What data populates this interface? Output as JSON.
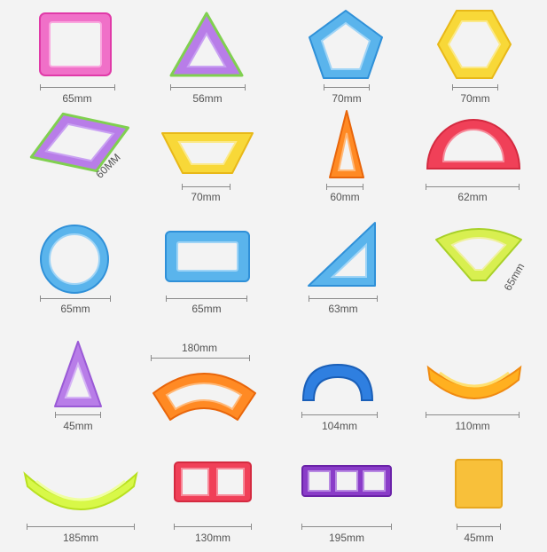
{
  "pieces": [
    {
      "name": "square",
      "size": "65mm"
    },
    {
      "name": "triangle",
      "size": "56mm"
    },
    {
      "name": "pentagon",
      "size": "70mm"
    },
    {
      "name": "hexagon",
      "size": "70mm"
    },
    {
      "name": "rhombus",
      "size": "60MM"
    },
    {
      "name": "trapezoid",
      "size": "70mm"
    },
    {
      "name": "tall-triangle",
      "size": "60mm"
    },
    {
      "name": "semicircle",
      "size": "62mm"
    },
    {
      "name": "ring",
      "size": "65mm"
    },
    {
      "name": "rectangle",
      "size": "65mm"
    },
    {
      "name": "right-triangle",
      "size": "63mm"
    },
    {
      "name": "fan",
      "size": "65mm"
    },
    {
      "name": "small-triangle",
      "size": "45mm"
    },
    {
      "name": "large-arc",
      "size": "180mm"
    },
    {
      "name": "arch",
      "size": "104mm"
    },
    {
      "name": "curved-bar",
      "size": "110mm"
    },
    {
      "name": "long-curve",
      "size": "185mm"
    },
    {
      "name": "double-square",
      "size": "130mm"
    },
    {
      "name": "triple-square",
      "size": "195mm"
    },
    {
      "name": "solid-square",
      "size": "45mm"
    }
  ]
}
